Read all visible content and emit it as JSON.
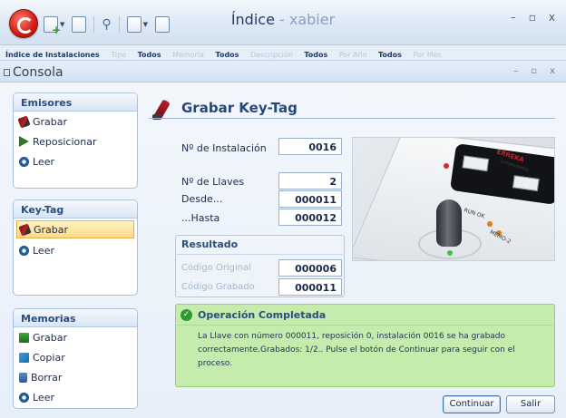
{
  "app": {
    "title_main": "Índice",
    "title_sep": " - ",
    "title_user": "xabier",
    "controls": {
      "minimize": "–",
      "restore": "▫",
      "close": "x"
    }
  },
  "tabs_row": {
    "first": "Índice de Instalaciones",
    "items": [
      "Tipo",
      "Todos",
      "Memoria",
      "Todos",
      "Descripción",
      "Todos",
      "Por Año",
      "Todos",
      "Por Mes"
    ]
  },
  "consola": {
    "title": "Consola",
    "controls": {
      "minimize": "–",
      "restore": "▫",
      "close": "x"
    }
  },
  "sidebar": {
    "emisores": {
      "title": "Emisores",
      "items": [
        "Grabar",
        "Reposicionar",
        "Leer"
      ]
    },
    "keytag": {
      "title": "Key-Tag",
      "items": [
        "Grabar",
        "Leer"
      ],
      "selected": "Grabar"
    },
    "memorias": {
      "title": "Memorias",
      "items": [
        "Grabar",
        "Copiar",
        "Borrar",
        "Leer"
      ]
    }
  },
  "content": {
    "title": "Grabar Key-Tag",
    "fields": {
      "instalacion": {
        "label": "Nº de Instalación",
        "value": "0016"
      },
      "llaves": {
        "label": "Nº de Llaves",
        "value": "2"
      },
      "desde": {
        "label": "Desde...",
        "value": "000011"
      },
      "hasta": {
        "label": "...Hasta",
        "value": "000012"
      }
    },
    "resultado": {
      "title": "Resultado",
      "original": {
        "label": "Código Original",
        "value": "000006"
      },
      "grabado": {
        "label": "Código Grabado",
        "value": "000011"
      }
    },
    "photo": {
      "brand": "ERREKA",
      "brand_sub": "AUTOMATISMOS",
      "run_label": "RUN OK",
      "memo_label": "MEMO-2"
    },
    "success": {
      "title": "Operación Completada",
      "message": "La Llave con número 000011, reposición 0, instalación 0016 se ha grabado correctamente.Grabados: 1/2.. Pulse el botón de Continuar para seguir con el proceso."
    },
    "buttons": {
      "continuar": "Continuar",
      "salir": "Salir"
    }
  },
  "colors": {
    "accent": "#25487c",
    "success_bg": "#c5ecad",
    "selected_bg": "#ffd984"
  }
}
